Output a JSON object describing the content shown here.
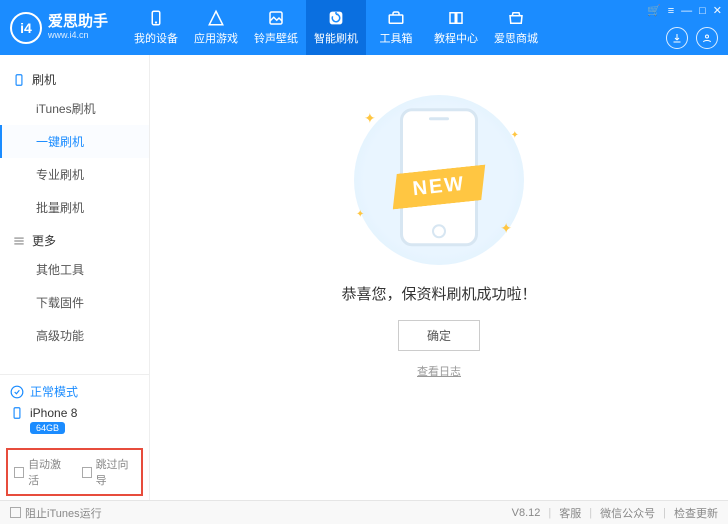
{
  "brand": {
    "name": "爱思助手",
    "url": "www.i4.cn",
    "icon_text": "i4"
  },
  "top_nav": [
    {
      "label": "我的设备"
    },
    {
      "label": "应用游戏"
    },
    {
      "label": "铃声壁纸"
    },
    {
      "label": "智能刷机",
      "active": true
    },
    {
      "label": "工具箱"
    },
    {
      "label": "教程中心"
    },
    {
      "label": "爱思商城"
    }
  ],
  "win_controls": {
    "cart": "🛒",
    "menu": "≡",
    "min": "—",
    "max": "□",
    "close": "✕"
  },
  "sidebar": {
    "cat_flash": "刷机",
    "flash_items": [
      {
        "label": "iTunes刷机"
      },
      {
        "label": "一键刷机",
        "active": true
      },
      {
        "label": "专业刷机"
      },
      {
        "label": "批量刷机"
      }
    ],
    "cat_more": "更多",
    "more_items": [
      {
        "label": "其他工具"
      },
      {
        "label": "下载固件"
      },
      {
        "label": "高级功能"
      }
    ],
    "mode_label": "正常模式",
    "device_name": "iPhone 8",
    "device_badge": "64GB",
    "auto_activate": "自动激活",
    "skip_wizard": "跳过向导"
  },
  "main": {
    "ribbon": "NEW",
    "message": "恭喜您，保资料刷机成功啦！",
    "ok": "确定",
    "log": "查看日志"
  },
  "statusbar": {
    "block_itunes": "阻止iTunes运行",
    "version": "V8.12",
    "support": "客服",
    "wechat": "微信公众号",
    "update": "检查更新"
  }
}
